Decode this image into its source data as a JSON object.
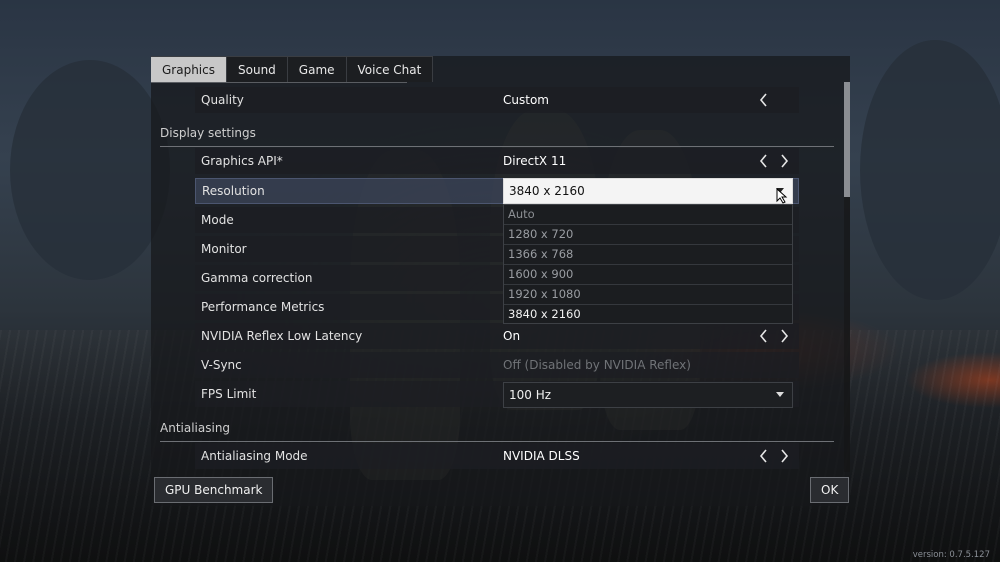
{
  "tabs": [
    {
      "label": "Graphics",
      "active": true
    },
    {
      "label": "Sound",
      "active": false
    },
    {
      "label": "Game",
      "active": false
    },
    {
      "label": "Voice Chat",
      "active": false
    }
  ],
  "settings": {
    "quality": {
      "label": "Quality",
      "value": "Custom"
    },
    "display_section": "Display settings",
    "graphics_api": {
      "label": "Graphics API*",
      "value": "DirectX 11"
    },
    "resolution": {
      "label": "Resolution",
      "value": "3840 x 2160"
    },
    "mode": {
      "label": "Mode"
    },
    "monitor": {
      "label": "Monitor"
    },
    "gamma": {
      "label": "Gamma correction"
    },
    "perf_metrics": {
      "label": "Performance Metrics"
    },
    "reflex": {
      "label": "NVIDIA Reflex Low Latency",
      "value": "On"
    },
    "vsync": {
      "label": "V-Sync",
      "value": "Off (Disabled by NVIDIA Reflex)"
    },
    "fps_limit": {
      "label": "FPS Limit",
      "value": "100 Hz"
    },
    "aa_section": "Antialiasing",
    "aa_mode": {
      "label": "Antialiasing Mode",
      "value": "NVIDIA DLSS"
    }
  },
  "resolution_options": [
    "Auto",
    "1280 x 720",
    "1366 x 768",
    "1600 x 900",
    "1920 x 1080",
    "3840 x 2160"
  ],
  "footer": {
    "benchmark_label": "GPU Benchmark",
    "ok_label": "OK"
  },
  "version_text": "version: 0.7.5.127",
  "colors": {
    "active_tab": "#c8c8c8",
    "selected_row": "#3c465a",
    "panel": "#16181b"
  }
}
